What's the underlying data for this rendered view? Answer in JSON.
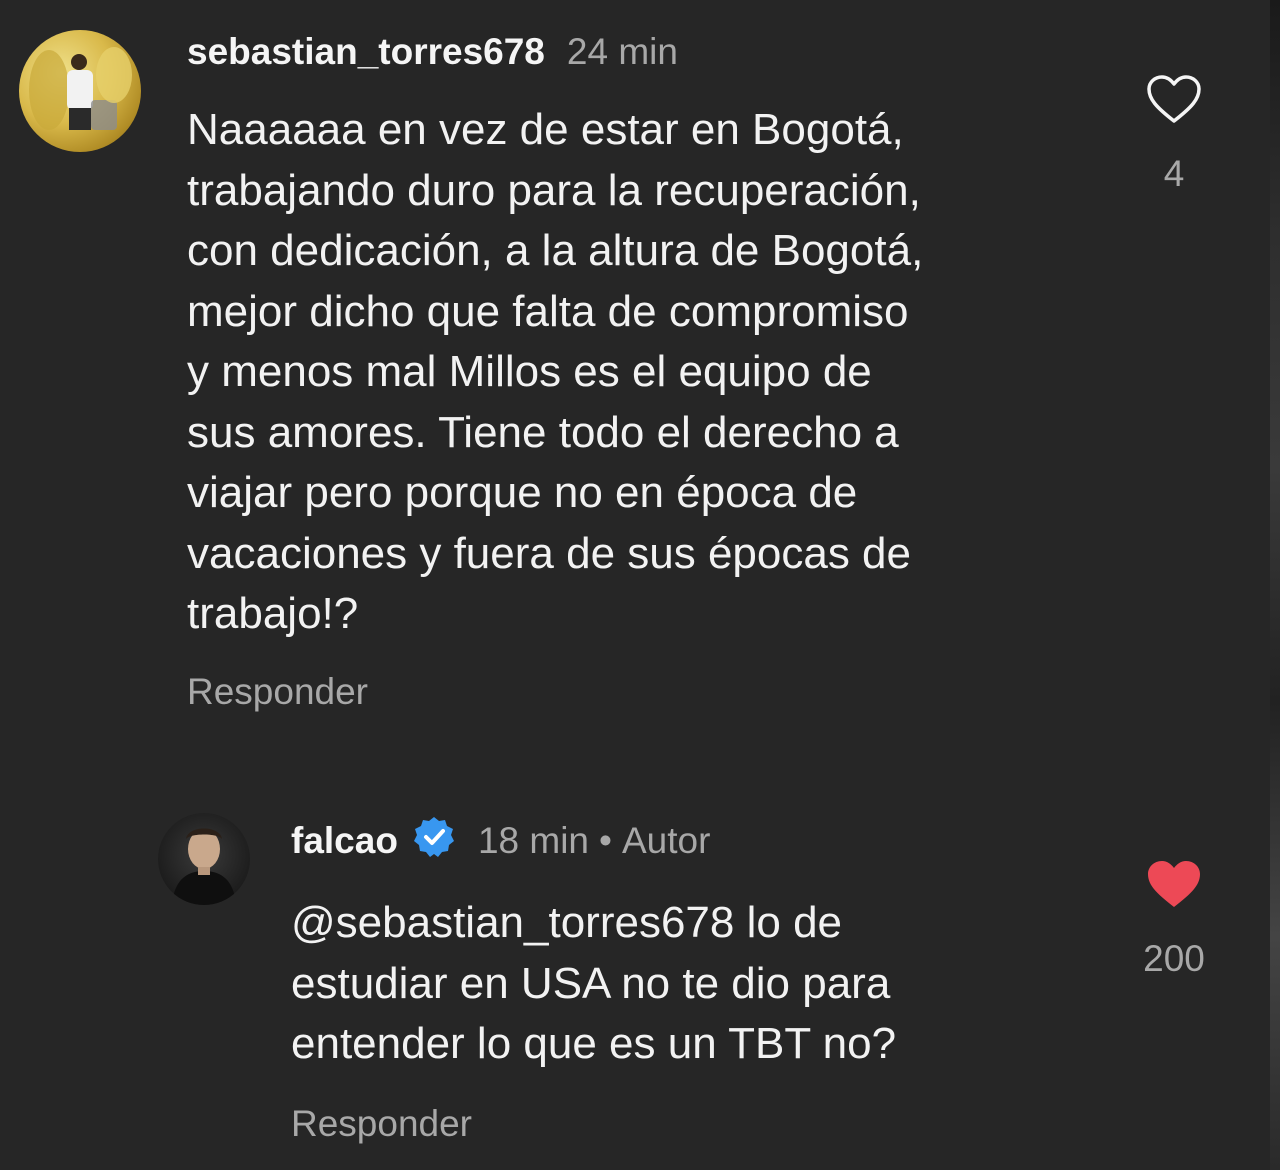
{
  "comments": [
    {
      "username": "sebastian_torres678",
      "time": "24 min",
      "text": "Naaaaaa en vez de estar en Bogotá,\ntrabajando duro para la recuperación,\ncon dedicación, a la altura de Bogotá,\nmejor dicho que falta de compromiso\ny menos mal Millos es el equipo de\nsus amores. Tiene todo el derecho a\nviajar pero porque no en época de\nvacaciones y fuera de sus épocas de\ntrabajo!?",
      "reply_label": "Responder",
      "likes": "4",
      "liked": false,
      "like_icon": "heart-outline-icon"
    },
    {
      "username": "falcao",
      "verified": true,
      "time": "18 min",
      "separator": "•",
      "author_tag": "Autor",
      "text": "@sebastian_torres678 lo de\nestudiar en USA no te dio para\nentender lo que es un TBT no?",
      "reply_label": "Responder",
      "likes": "200",
      "liked": true,
      "like_icon": "heart-filled-icon"
    }
  ],
  "colors": {
    "background": "#262626",
    "text_primary": "#f5f5f5",
    "text_secondary": "#a8a8a8",
    "verified_blue": "#3897f0",
    "like_red": "#ed4956"
  }
}
